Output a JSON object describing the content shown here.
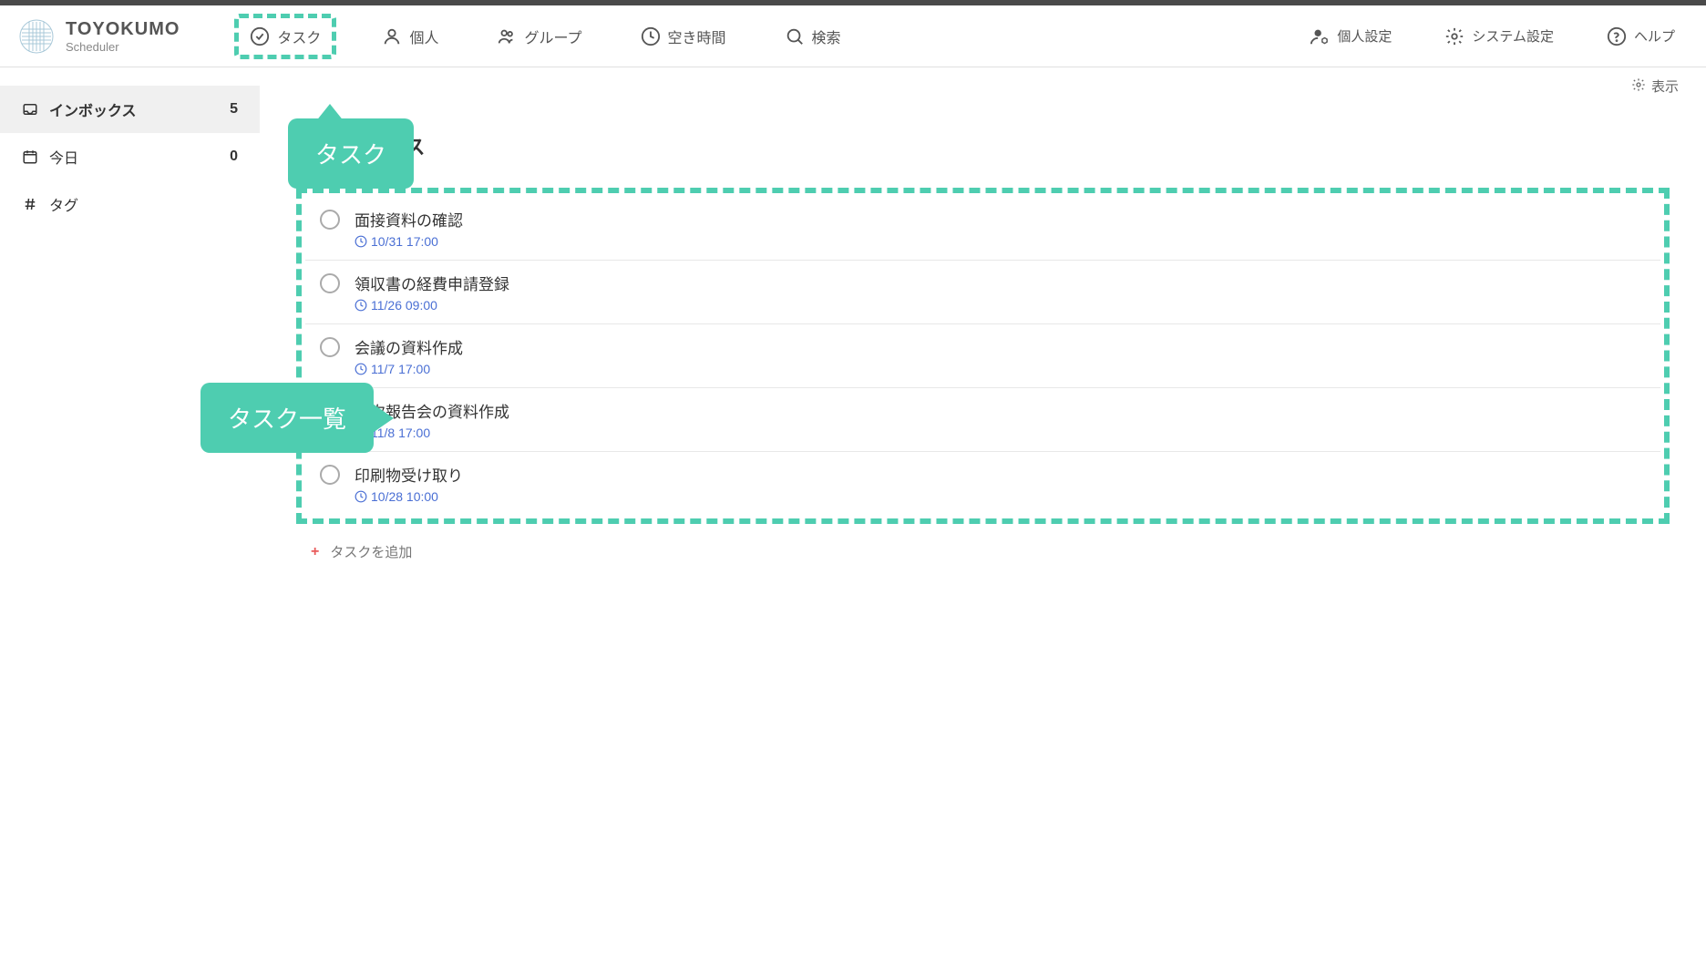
{
  "brand": {
    "name": "TOYOKUMO",
    "sub": "Scheduler"
  },
  "nav": {
    "task": "タスク",
    "personal": "個人",
    "group": "グループ",
    "freetime": "空き時間",
    "search": "検索"
  },
  "nav_right": {
    "personal_settings": "個人設定",
    "system_settings": "システム設定",
    "help": "ヘルプ"
  },
  "sidebar": {
    "inbox": {
      "label": "インボックス",
      "count": "5"
    },
    "today": {
      "label": "今日",
      "count": "0"
    },
    "tag": {
      "label": "タグ"
    }
  },
  "display_toggle": "表示",
  "content_title": "インボックス",
  "tasks": [
    {
      "title": "面接資料の確認",
      "date": "10/31 17:00"
    },
    {
      "title": "領収書の経費申請登録",
      "date": "11/26 09:00"
    },
    {
      "title": "会議の資料作成",
      "date": "11/7 17:00"
    },
    {
      "title": "月次報告会の資料作成",
      "date": "11/8 17:00"
    },
    {
      "title": "印刷物受け取り",
      "date": "10/28 10:00"
    }
  ],
  "add_task": "タスクを追加",
  "callouts": {
    "task": "タスク",
    "list": "タスク一覧"
  }
}
